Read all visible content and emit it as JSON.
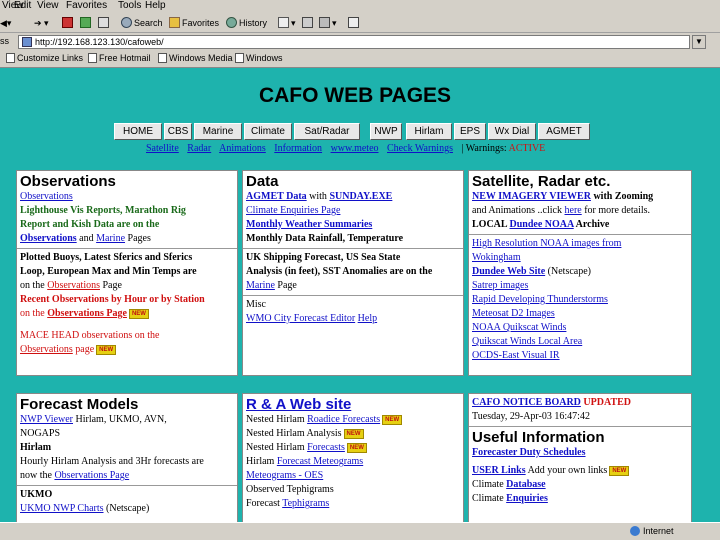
{
  "menu": [
    "View",
    "Edit",
    "View",
    "Favorites",
    "Tools",
    "Help"
  ],
  "toolbar": {
    "forward": "Forward",
    "search": "Search",
    "favorites": "Favorites",
    "history": "History"
  },
  "address": {
    "label": "ss",
    "url": "http://192.168.123.130/cafoweb/"
  },
  "links": [
    "Customize Links",
    "Free Hotmail",
    "Windows Media",
    "Windows"
  ],
  "page": {
    "title": "CAFO WEB PAGES",
    "nav": [
      "HOME",
      "CBS",
      "Marine",
      "Climate",
      "Sat/Radar",
      "NWP",
      "Hirlam",
      "EPS",
      "Wx Dial",
      "AGMET"
    ],
    "sublinks": [
      "Satellite",
      "Radar",
      "Animations",
      "Information",
      "www.meteo",
      "Check Warnings"
    ],
    "warnings_label": "| Warnings:",
    "warnings_status": "ACTIVE"
  },
  "panels": {
    "observations": {
      "title": "Observations",
      "l1": "Observations",
      "l2": "Lighthouse Vis Reports, Marathon Rig",
      "l3": "Report and Kish Data are on the",
      "l4a": "Observations",
      "l4b": " and ",
      "l4c": "Marine",
      "l4d": " Pages",
      "l5": "Plotted Buoys, Latest Sferics and Sferics",
      "l6": "Loop, European Max and Min Temps are",
      "l7a": "on the ",
      "l7b": "Observations",
      "l7c": " Page",
      "l8": "Recent Observations by Hour or by Station",
      "l9a": "on the ",
      "l9b": "Observations Page",
      "l10": "MACE HEAD observations on the",
      "l11a": "Observations",
      "l11b": " page"
    },
    "data": {
      "title": "Data",
      "l1a": "AGMET Data",
      "l1b": " with ",
      "l1c": "SUNDAY.EXE",
      "l2": "Climate Enquiries Page",
      "l3": "Monthly Weather Summaries",
      "l4": "Monthly Data Rainfall, Temperature",
      "l5": "UK Shipping Forecast, US Sea State",
      "l6": "Analysis (in feet), SST Anomalies are on the",
      "l7a": "Marine",
      "l7b": " Page",
      "l8": "Misc",
      "l9a": "WMO City Forecast Editor",
      "l9b": "Help"
    },
    "satellite": {
      "title": "Satellite, Radar etc.",
      "l1a": "NEW IMAGERY VIEWER",
      "l1b": " with Zooming",
      "l2a": "and Animations ..click ",
      "l2b": "here",
      "l2c": " for more details.",
      "l3a": "LOCAL ",
      "l3b": "Dundee NOAA",
      "l3c": " Archive",
      "l4": "High Resolution NOAA images from",
      "l5": "Wokingham",
      "l6a": "Dundee Web Site",
      "l6b": " (Netscape)",
      "l7": "Satrep images",
      "l8": "Rapid Developing Thunderstorms",
      "l9": "Meteosat D2 Images",
      "l10": "NOAA Quikscat Winds",
      "l11": "Quikscat Winds Local Area",
      "l12": "OCDS-East Visual IR"
    },
    "forecast": {
      "title": "Forecast Models",
      "l1a": "NWP Viewer",
      "l1b": " Hirlam, UKMO, AVN,",
      "l2": "NOGAPS",
      "l3": "Hirlam",
      "l4": "Hourly Hirlam Analysis and 3Hr forecasts are",
      "l5a": "now the ",
      "l5b": "Observations Page",
      "l6": "UKMO",
      "l7a": "UKMO NWP Charts",
      "l7b": " (Netscape)"
    },
    "ra": {
      "title": "R & A Web site",
      "l1a": "Nested Hirlam ",
      "l1b": "Roadice Forecasts",
      "l2": "Nested Hirlam Analysis",
      "l3a": "Nested Hirlam ",
      "l3b": "Forecasts",
      "l4a": "Hirlam ",
      "l4b": "Forecast Meteograms",
      "l5": "Meteograms - OES",
      "l6": "Observed Tephigrams",
      "l7a": "Forecast ",
      "l7b": "Tephigrams"
    },
    "notice": {
      "title_a": "CAFO NOTICE BOARD",
      "title_b": " UPDATED",
      "date": "Tuesday, 29-Apr-03 16:47:42",
      "useful": "Useful Information",
      "l1": "Forecaster Duty Schedules",
      "l2a": "USER Links",
      "l2b": " Add your own links",
      "l3a": "Climate ",
      "l3b": "Database",
      "l4a": "Climate ",
      "l4b": "Enquiries"
    },
    "new_badge": "NEW"
  },
  "status": {
    "zone": "Internet"
  },
  "colors": {
    "page_bg": "#1eb3ad",
    "link": "#1010c8",
    "alert": "#d01010",
    "chrome": "#d4d0c8"
  }
}
